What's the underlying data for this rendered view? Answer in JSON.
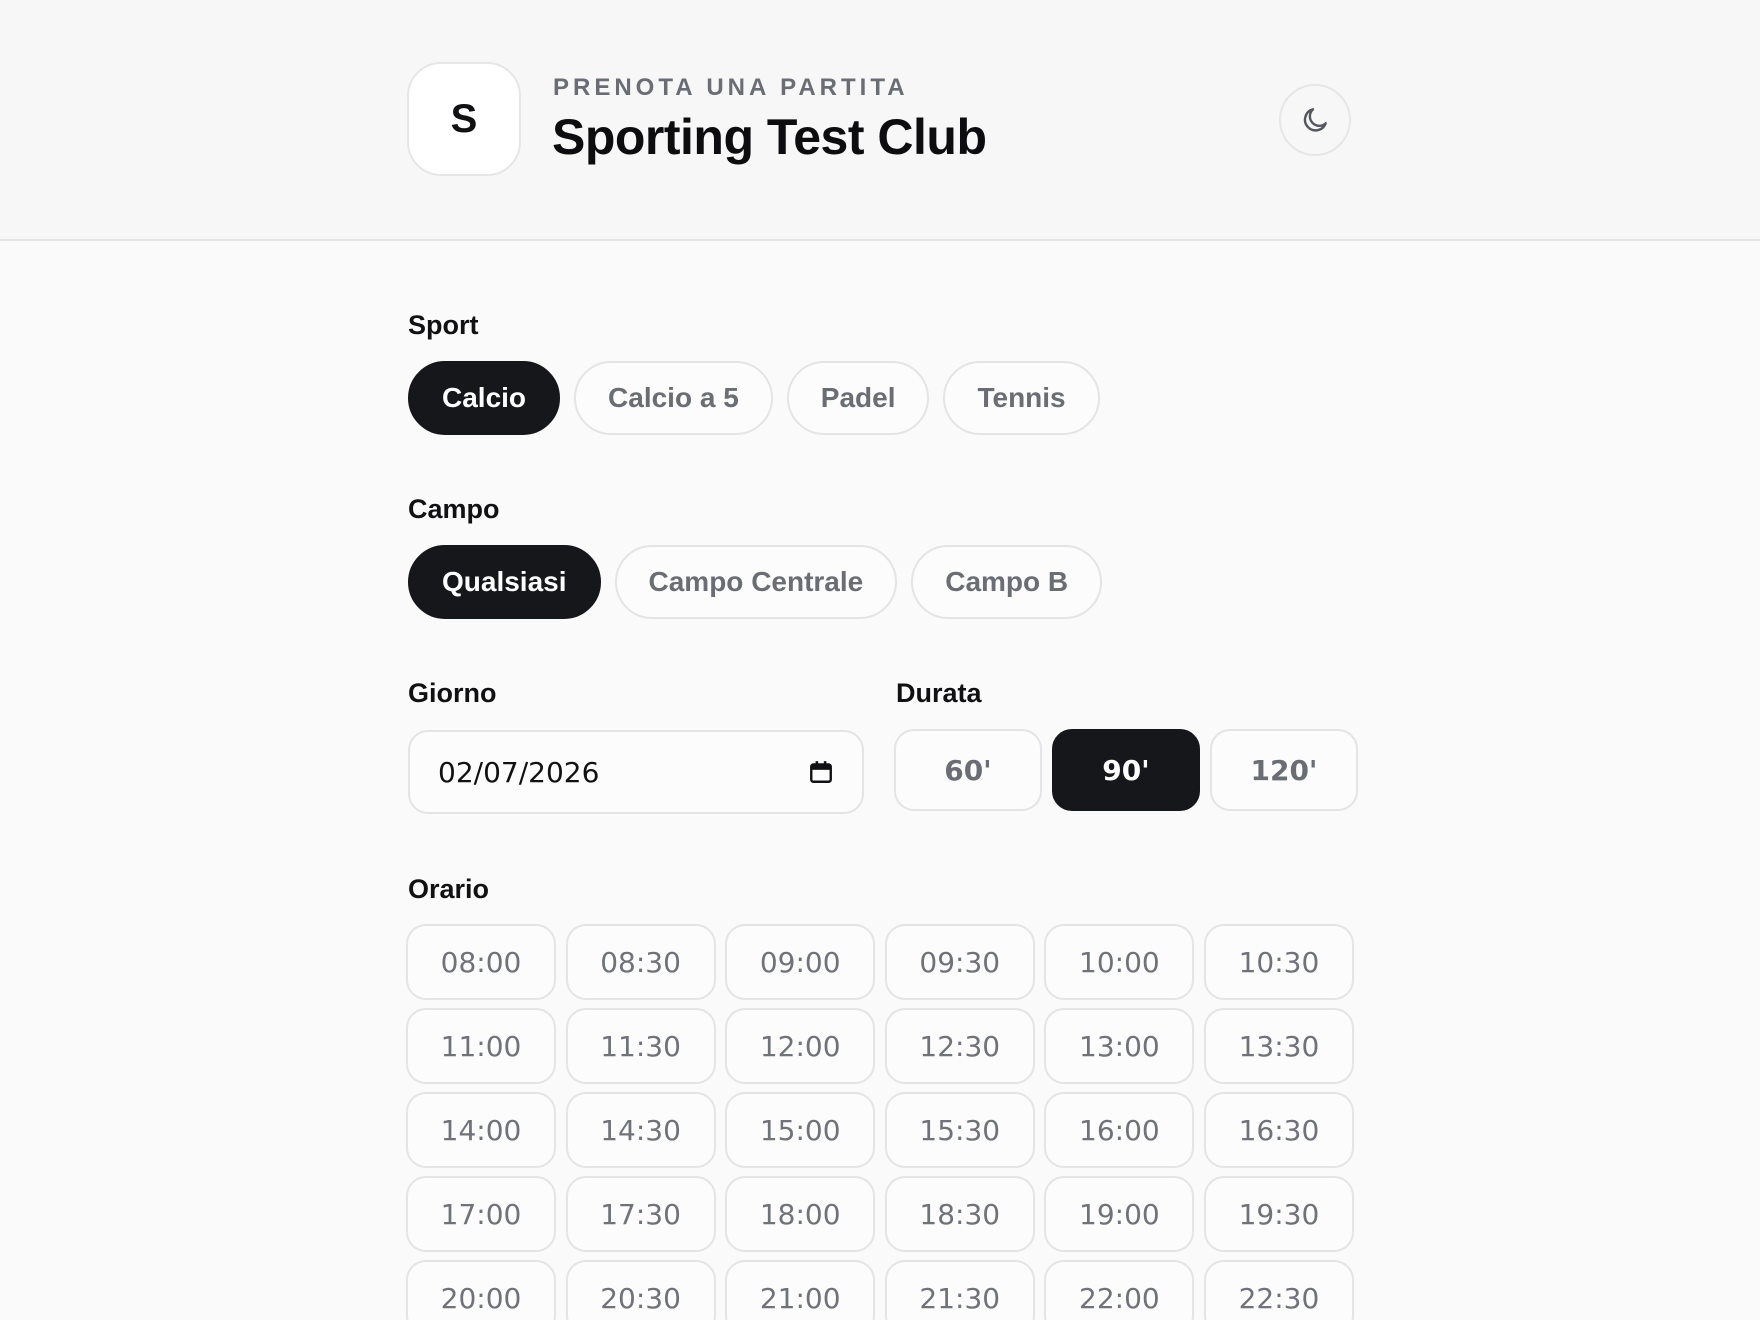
{
  "header": {
    "logo_letter": "S",
    "kicker": "PRENOTA UNA PARTITA",
    "title": "Sporting Test Club",
    "theme_icon": "moon-icon"
  },
  "sport": {
    "label": "Sport",
    "options": [
      "Calcio",
      "Calcio a 5",
      "Padel",
      "Tennis"
    ],
    "selected": "Calcio"
  },
  "campo": {
    "label": "Campo",
    "options": [
      "Qualsiasi",
      "Campo Centrale",
      "Campo B"
    ],
    "selected": "Qualsiasi"
  },
  "giorno": {
    "label": "Giorno",
    "value": "02/07/2026",
    "icon": "calendar-icon"
  },
  "durata": {
    "label": "Durata",
    "options": [
      "60'",
      "90'",
      "120'"
    ],
    "selected": "90'"
  },
  "orario": {
    "label": "Orario",
    "slots": [
      "08:00",
      "08:30",
      "09:00",
      "09:30",
      "10:00",
      "10:30",
      "11:00",
      "11:30",
      "12:00",
      "12:30",
      "13:00",
      "13:30",
      "14:00",
      "14:30",
      "15:00",
      "15:30",
      "16:00",
      "16:30",
      "17:00",
      "17:30",
      "18:00",
      "18:30",
      "19:00",
      "19:30",
      "20:00",
      "20:30",
      "21:00",
      "21:30",
      "22:00",
      "22:30"
    ]
  },
  "colors": {
    "accent": "#16171a",
    "muted_text": "#6b6d74",
    "border": "#e4e4e6"
  }
}
